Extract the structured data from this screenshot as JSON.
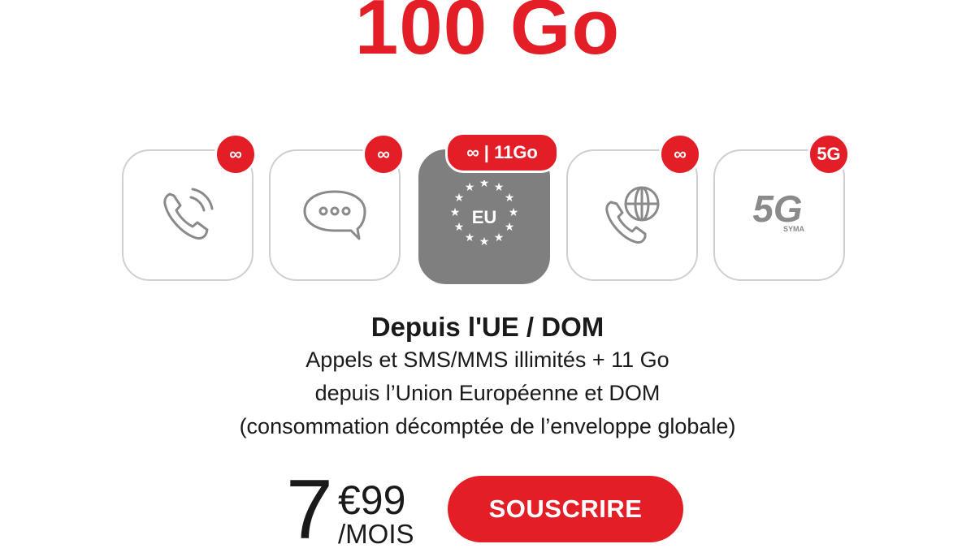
{
  "plan": {
    "data_amount": "100 Go"
  },
  "features": [
    {
      "icon": "phone-call-icon",
      "badge": "∞",
      "badge_icon": "infinity-icon"
    },
    {
      "icon": "chat-bubble-icon",
      "badge": "∞",
      "badge_icon": "infinity-icon"
    },
    {
      "icon": "eu-stars-icon",
      "icon_text": "EU",
      "badge_infinity": "∞",
      "badge_text": "| 11Go",
      "active": true
    },
    {
      "icon": "phone-globe-icon",
      "badge": "∞",
      "badge_icon": "infinity-icon"
    },
    {
      "icon": "5g-logo-icon",
      "icon_text": "5G",
      "icon_subtext": "SYMA",
      "badge": "5G"
    }
  ],
  "detail": {
    "title": "Depuis l'UE / DOM",
    "lines": [
      "Appels et SMS/MMS illimités + 11 Go",
      "depuis l’Union Européenne et DOM",
      "(consommation décomptée de l’enveloppe globale)"
    ]
  },
  "price": {
    "euros": "7",
    "cents": "€99",
    "unit": "/MOIS"
  },
  "cta": {
    "label": "SOUSCRIRE"
  },
  "colors": {
    "accent": "#e41e26",
    "active_card": "#7f7f7f",
    "card_border": "#cfcfcf",
    "icon_gray": "#8a8a8a"
  }
}
